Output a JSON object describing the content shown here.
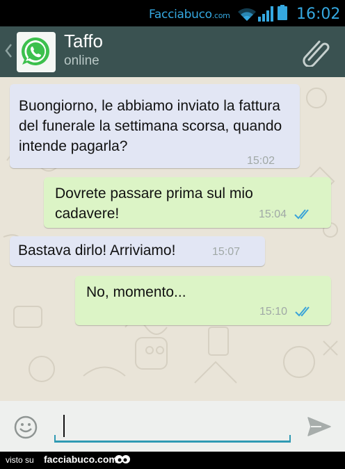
{
  "status_bar": {
    "brand": "Facciabuco",
    "brand_suffix": ".com",
    "time": "16:02",
    "icons": [
      "wifi-icon",
      "signal-icon",
      "battery-icon"
    ]
  },
  "header": {
    "contact_name": "Taffo",
    "contact_status": "online",
    "icons": [
      "back-icon",
      "whatsapp-logo",
      "paperclip-icon"
    ]
  },
  "messages": [
    {
      "direction": "incoming",
      "text": "Buongiorno, le abbiamo inviato la fattura del funerale la settimana scorsa, quando intende pagarla?",
      "time": "15:02"
    },
    {
      "direction": "outgoing",
      "text": "Dovrete passare prima sul mio cadavere!",
      "time": "15:04",
      "status": "read"
    },
    {
      "direction": "incoming",
      "text": "Bastava dirlo! Arriviamo!",
      "time": "15:07"
    },
    {
      "direction": "outgoing",
      "text": "No, momento...",
      "time": "15:10",
      "status": "read"
    }
  ],
  "input_bar": {
    "value": "",
    "icons": [
      "smiley-icon",
      "send-icon"
    ]
  },
  "footer": {
    "prefix": "visto su",
    "site": "facciabuco.com"
  },
  "colors": {
    "action_bar": "#3a5251",
    "incoming_bubble": "#e2e6f4",
    "outgoing_bubble": "#dcf4c6",
    "status_bar_text": "#35a8e0",
    "read_ticks": "#3aa3d8",
    "input_underline": "#2f9ab3"
  }
}
